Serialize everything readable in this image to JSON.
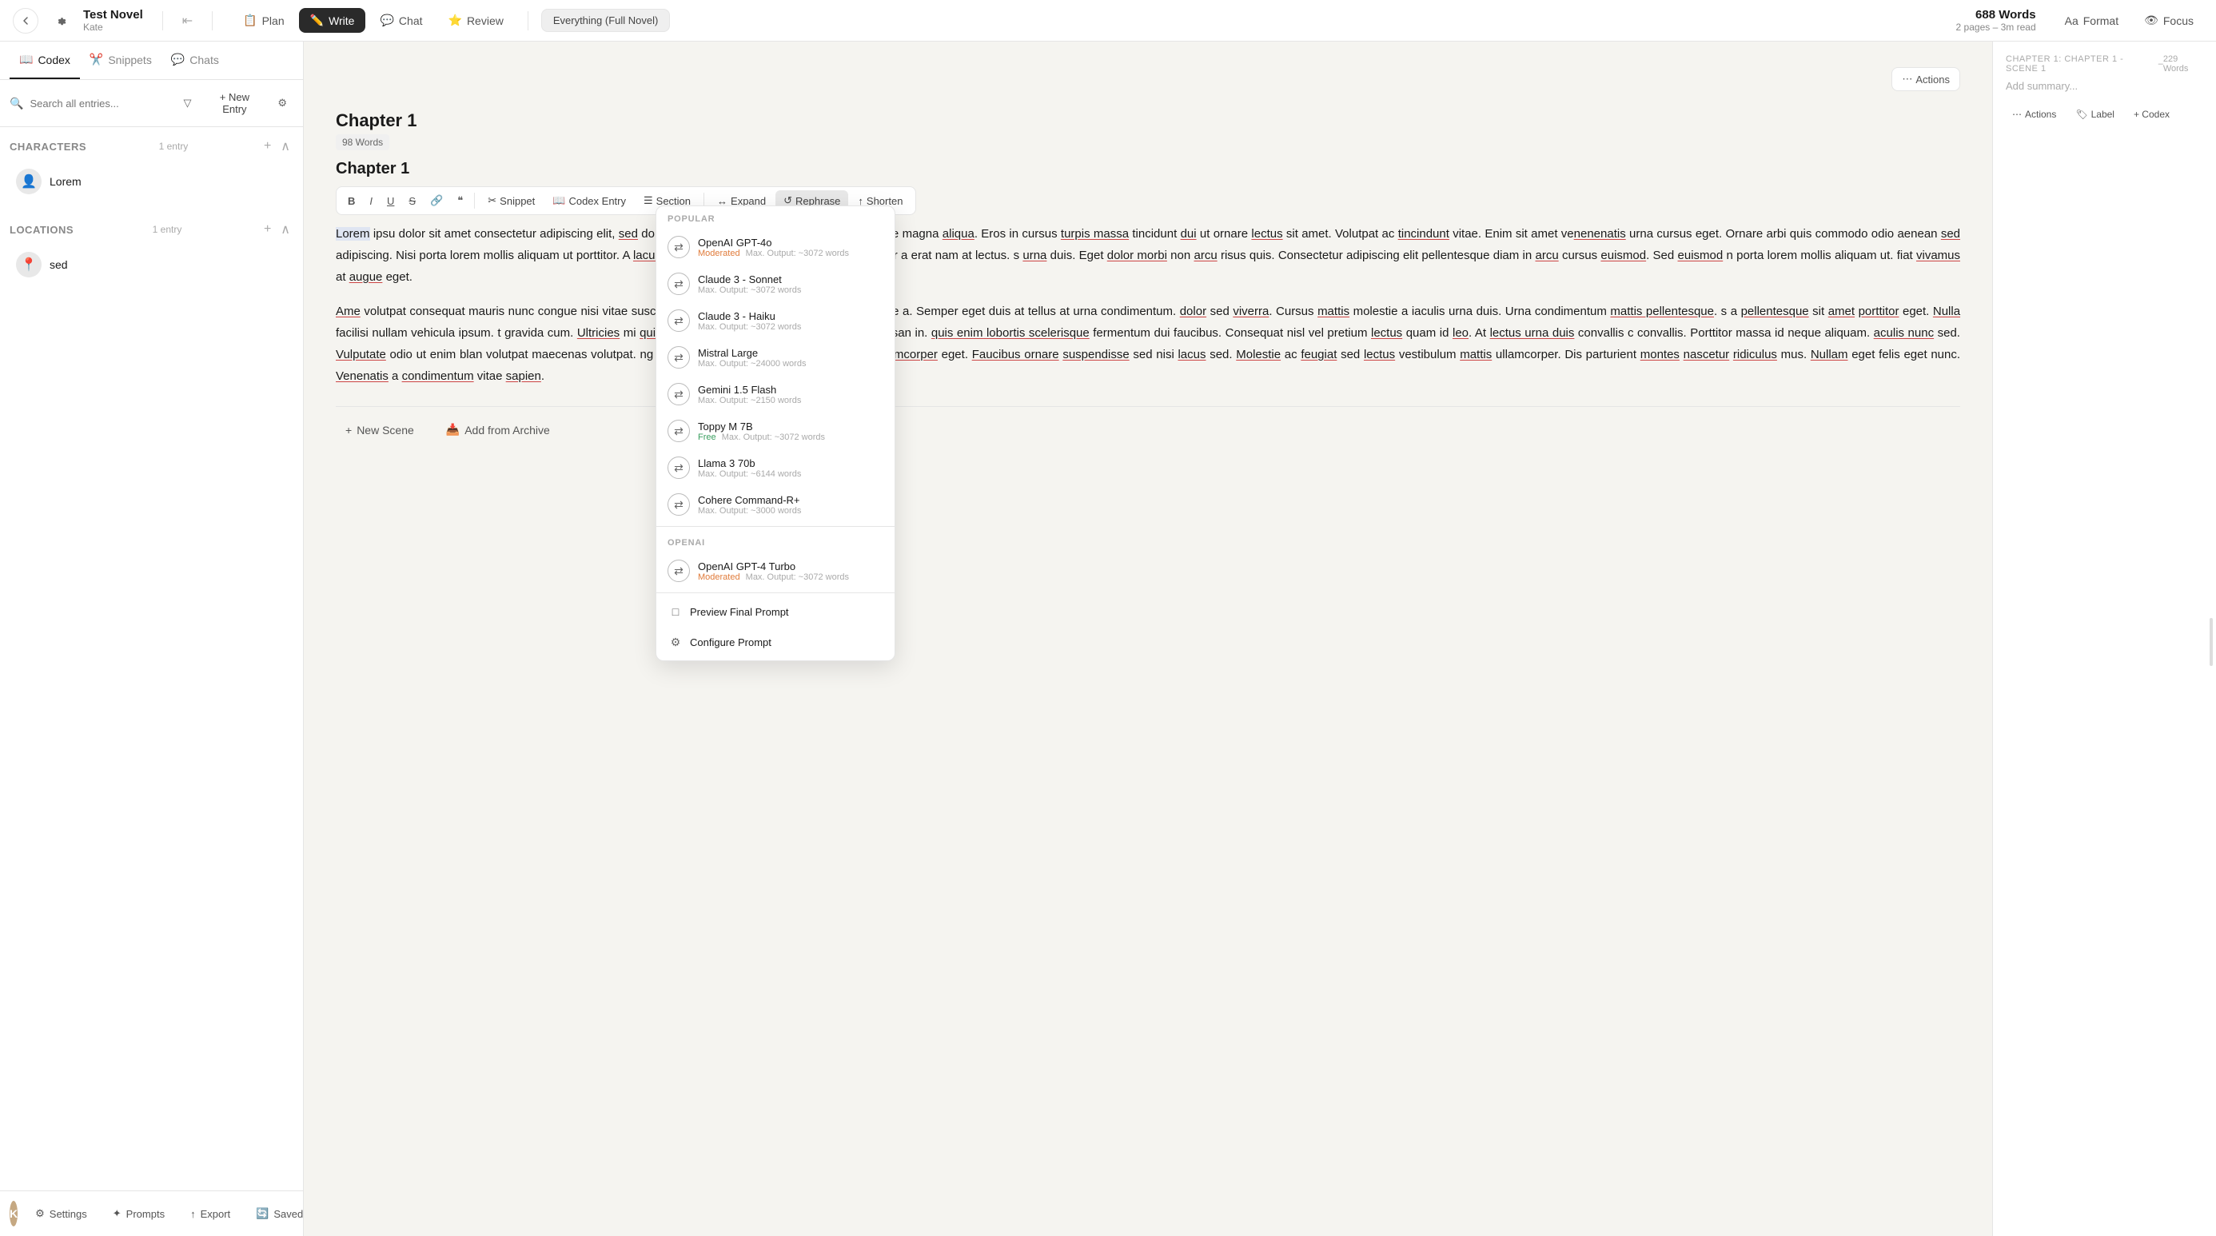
{
  "app": {
    "title": "Test Novel",
    "subtitle": "Kate"
  },
  "topbar": {
    "nav_items": [
      {
        "id": "plan",
        "label": "Plan",
        "icon": "📋",
        "active": false
      },
      {
        "id": "write",
        "label": "Write",
        "icon": "✏️",
        "active": true
      },
      {
        "id": "chat",
        "label": "Chat",
        "icon": "💬",
        "active": false
      },
      {
        "id": "review",
        "label": "Review",
        "icon": "⭐",
        "active": false
      }
    ],
    "status_label": "Everything (Full Novel)",
    "word_count": "688 Words",
    "word_meta": "2 pages – 3m read",
    "format_label": "Format",
    "focus_label": "Focus"
  },
  "sidebar": {
    "tabs": [
      {
        "id": "codex",
        "label": "Codex",
        "active": true
      },
      {
        "id": "snippets",
        "label": "Snippets",
        "active": false
      },
      {
        "id": "chats",
        "label": "Chats",
        "active": false
      }
    ],
    "search_placeholder": "Search all entries...",
    "new_entry_label": "+ New Entry",
    "sections": {
      "characters": {
        "title": "Characters",
        "count": "1 entry",
        "entries": [
          {
            "name": "Lorem",
            "icon": "person"
          }
        ]
      },
      "locations": {
        "title": "Locations",
        "count": "1 entry",
        "entries": [
          {
            "name": "sed",
            "icon": "location"
          }
        ]
      }
    }
  },
  "bottombar": {
    "settings_label": "Settings",
    "prompts_label": "Prompts",
    "export_label": "Export",
    "saved_label": "Saved"
  },
  "editor": {
    "chapter_title": "Chapter 1",
    "scene_title": "Chapter 1",
    "word_badge": "98 Words",
    "actions_label": "Actions",
    "toolbar": {
      "bold": "B",
      "italic": "I",
      "underline": "U",
      "strikethrough": "S",
      "link": "🔗",
      "quote": "❞",
      "snippet_label": "Snippet",
      "codex_label": "Codex Entry",
      "section_label": "Section",
      "expand_label": "Expand",
      "rephrase_label": "Rephrase",
      "shorten_label": "Shorten"
    },
    "content_p1": "Lorem ipsum dolor sit amet consectetur adipiscing elit, sed do eiusmod tempor incididunt ut labore et dolore magna aliqua. Eros in cursus turpis massa tincidunt dui ut ornare lectus sit amet. Volutpat ac tincindunt vitae. Enim sit amet venenatis urna cursus eget. Ornare arbi quis commodo odio aenean sed adipiscing. Nisi porta lorem mollis aliquam ut porttitor. A lacus vestibulum sed arcu. Dictum non consectetur a erat nam at lectus. s urna duis. Eget dolor morbi non arcu risus quis. Consectetur adipiscing elit pellentesque diam in arcu cursus euismod. Sed euismod nisi porta lorem mollis aliquam ut. fiat vivamus at augue eget.",
    "content_p2": "Amet volutpat consequat mauris nunc congue nisi vitae suscipit. donec massa sapien faucibus et molestie ac. Semper eget duis at tellus at urna condimentum. dolor sed viverra. Cursus mattis molestie a iaculis urna duis. Urna condimentum mattis pellentesque. s a pellentesque sit amet porttitor eget. Nulla facilisi nullam vehicula ipsum. t gravida cum. Ultricies mi quis hendrerit dolor magna. arcu viverra accumsan in. quis enim lobortis scelerisque fermentum dui faucibus. Consequat nisl vel pretium lectus quam id leo. At lectus urna duis convallis convallis. Porttitor massa id neque aliquam. aculis nunc sed. Vulputate odio ut enim blandit volutpat maecenas volutpat. ng elit ut aliquam purus sit amet luctus. Ele ullamcorper eget. Faucibus ornare suspendisse sed nisi lacus sed. Molestie ac feugiat sed lectus vestibulum mattis ullamcorper. Dis parturient montes nascetur ridiculus mus. Nullam eget felis eget nunc. Venenatis a condimentum vitae sapien."
  },
  "ai_dropdown": {
    "popular_header": "POPULAR",
    "openai_header": "OPENAI",
    "items_popular": [
      {
        "id": "gpt4o",
        "name": "OpenAI GPT-4o",
        "moderated": "Moderated",
        "output": "Max. Output: ~3072 words"
      },
      {
        "id": "claude3-sonnet",
        "name": "Claude 3 - Sonnet",
        "moderated": null,
        "output": "Max. Output: ~3072 words"
      },
      {
        "id": "claude3-haiku",
        "name": "Claude 3 - Haiku",
        "moderated": null,
        "output": "Max. Output: ~3072 words"
      },
      {
        "id": "mistral-large",
        "name": "Mistral Large",
        "moderated": null,
        "output": "Max. Output: ~24000 words"
      },
      {
        "id": "gemini-flash",
        "name": "Gemini 1.5 Flash",
        "moderated": null,
        "output": "Max. Output: ~2150 words"
      },
      {
        "id": "toppy-m7b",
        "name": "Toppy M 7B",
        "free": "Free",
        "output": "Max. Output: ~3072 words"
      },
      {
        "id": "llama3-70b",
        "name": "Llama 3 70b",
        "moderated": null,
        "output": "Max. Output: ~6144 words"
      },
      {
        "id": "cohere-cmd-r",
        "name": "Cohere Command-R+",
        "moderated": null,
        "output": "Max. Output: ~3000 words"
      }
    ],
    "items_openai": [
      {
        "id": "gpt4-turbo",
        "name": "OpenAI GPT-4 Turbo",
        "moderated": "Moderated",
        "output": "Max. Output: ~3072 words"
      }
    ],
    "preview_prompt_label": "Preview Final Prompt",
    "configure_prompt_label": "Configure Prompt"
  },
  "right_panel": {
    "scene_label": "CHAPTER 1: CHAPTER 1 - SCENE 1",
    "word_count": "229 Words",
    "summary_placeholder": "Add summary...",
    "actions_label": "Actions",
    "label_label": "Label",
    "codex_label": "+ Codex"
  },
  "bottom_editor": {
    "new_scene_label": "New Scene",
    "add_archive_label": "Add from Archive"
  }
}
